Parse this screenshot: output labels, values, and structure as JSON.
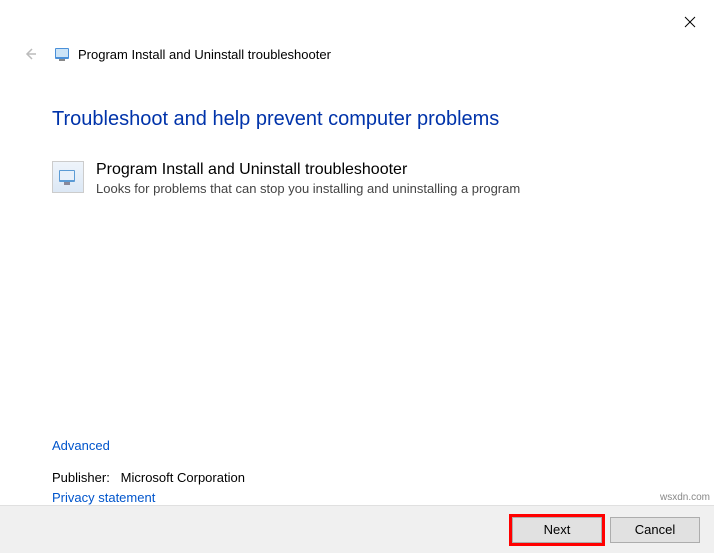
{
  "window": {
    "title": "Program Install and Uninstall troubleshooter"
  },
  "main": {
    "heading": "Troubleshoot and help prevent computer problems",
    "troubleshooter": {
      "title": "Program Install and Uninstall troubleshooter",
      "description": "Looks for problems that can stop you installing and uninstalling a program"
    }
  },
  "links": {
    "advanced": "Advanced",
    "privacy": "Privacy statement"
  },
  "publisher": {
    "label": "Publisher:",
    "value": "Microsoft Corporation"
  },
  "buttons": {
    "next": "Next",
    "cancel": "Cancel"
  },
  "watermark": "wsxdn.com"
}
